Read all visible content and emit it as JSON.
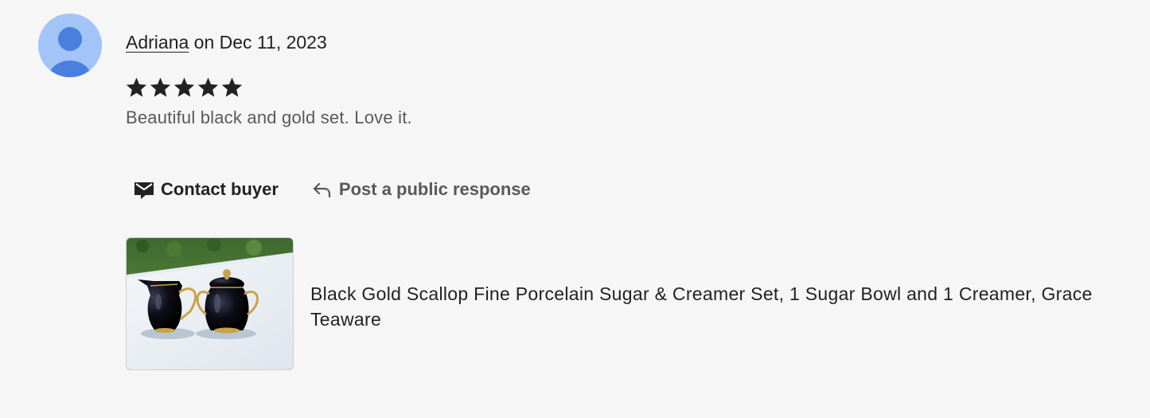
{
  "review": {
    "reviewer_name": "Adriana",
    "date_prefix": " on ",
    "date": "Dec 11, 2023",
    "rating": 5,
    "rating_max": 5,
    "text": "Beautiful black and gold set. Love it."
  },
  "actions": {
    "contact_label": "Contact buyer",
    "contact_icon": "envelope-icon",
    "respond_label": "Post a public response",
    "respond_icon": "reply-arrow-icon"
  },
  "product": {
    "title": "Black Gold Scallop Fine Porcelain Sugar & Creamer Set, 1 Sugar Bowl and 1 Creamer, Grace Teaware"
  },
  "colors": {
    "avatar_bg": "#a3c4f7",
    "avatar_figure": "#4a7fe0",
    "text_primary": "#222222",
    "text_secondary": "#595959"
  }
}
